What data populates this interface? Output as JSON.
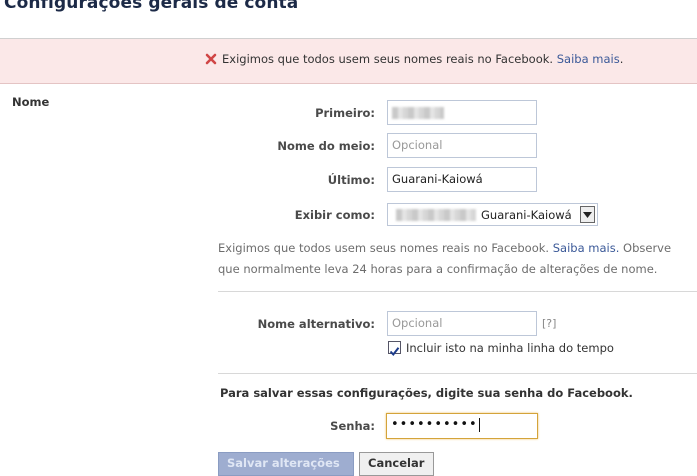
{
  "page": {
    "title": "Configurações gerais de conta"
  },
  "alert": {
    "text": "Exigimos que todos usem seus nomes reais no Facebook.",
    "link": "Saiba mais",
    "suffix": "."
  },
  "section": {
    "label": "Nome"
  },
  "fields": {
    "first": {
      "label": "Primeiro:"
    },
    "middle": {
      "label": "Nome do meio:",
      "placeholder": "Opcional"
    },
    "last": {
      "label": "Último:",
      "value": "Guarani-Kaiowá"
    },
    "display": {
      "label": "Exibir como:",
      "value": "Guarani-Kaiowá"
    }
  },
  "help": {
    "text1": "Exigimos que todos usem seus nomes reais no Facebook.",
    "link": "Saiba mais.",
    "text2": "Observe que normalmente leva 24 horas para a confirmação de alterações de nome."
  },
  "alternate": {
    "label": "Nome alternativo:",
    "placeholder": "Opcional",
    "help_mark": "[?]",
    "checkbox_label": "Incluir isto na minha linha do tempo",
    "checked": true
  },
  "password": {
    "prompt": "Para salvar essas configurações, digite sua senha do Facebook.",
    "label": "Senha:",
    "masked": "••••••••••"
  },
  "buttons": {
    "save": "Salvar alterações",
    "cancel": "Cancelar"
  },
  "colors": {
    "link": "#3b5998",
    "alert_bg": "#fbe8e8",
    "primary_button": "#9eadd0"
  }
}
